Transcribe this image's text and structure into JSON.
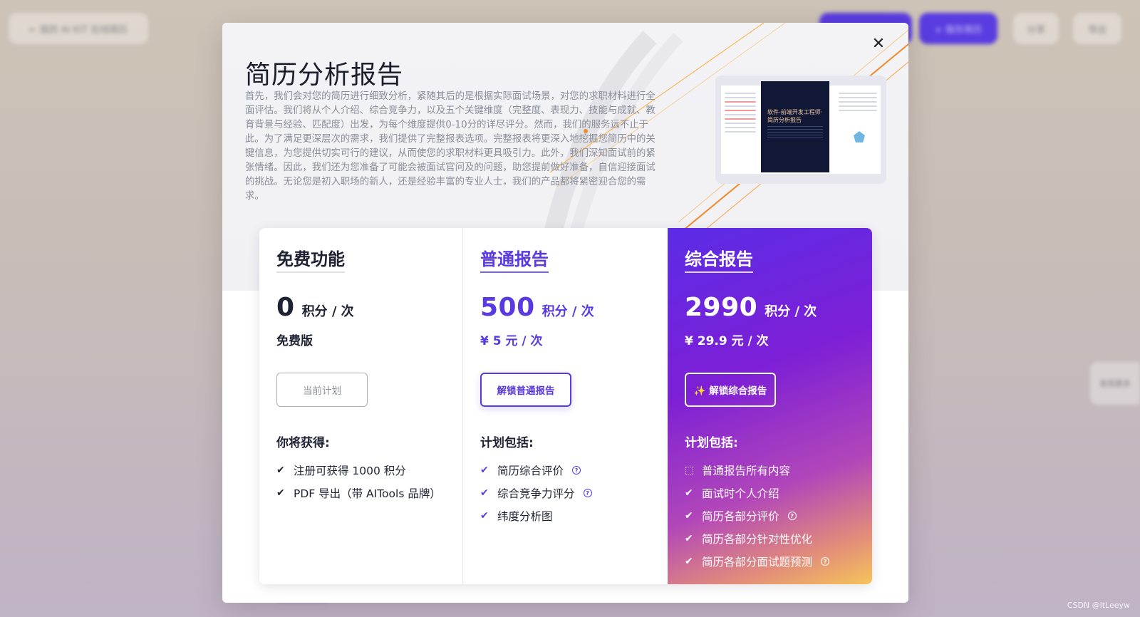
{
  "background": {
    "top_left_pill": "← 我的 AI KIT 在线简历",
    "pill_1": "",
    "pill_2": "+ 保存简历",
    "pill_3": "分享",
    "pill_4": "导出",
    "side_tab": "发现更多"
  },
  "modal": {
    "close_label": "✕",
    "title": "简历分析报告",
    "description": "首先，我们会对您的简历进行细致分析，紧随其后的是根据实际面试场景，对您的求职材料进行全面评估。我们将从个人介绍、综合竞争力，以及五个关键维度（完整度、表现力、技能与成就、教育背景与经验、匹配度）出发，为每个维度提供0-10分的详尽评分。然而，我们的服务远不止于此。为了满足更深层次的需求，我们提供了完整报表选项。完整报表将更深入地挖掘您简历中的关键信息，为您提供切实可行的建议，从而使您的求职材料更具吸引力。此外，我们深知面试前的紧张情绪。因此，我们还为您准备了可能会被面试官问及的问题，助您提前做好准备，自信迎接面试的挑战。无论您是初入职场的新人，还是经验丰富的专业人士，我们的产品都将紧密迎合您的需求。",
    "preview_cover_text": "软件-前端开发工程师·简历分析报告"
  },
  "plans": {
    "free": {
      "name": "免费功能",
      "price": "0",
      "unit": "积分 / 次",
      "sub": "免费版",
      "button": "当前计划",
      "features_title": "你将获得:",
      "features": [
        "注册可获得 1000 积分",
        "PDF 导出（带 AITools 品牌）"
      ]
    },
    "normal": {
      "name": "普通报告",
      "price": "500",
      "unit": "积分 / 次",
      "sub": "¥ 5  元 / 次",
      "button": "解锁普通报告",
      "features_title": "计划包括:",
      "features": [
        "简历综合评价",
        "综合竞争力评分",
        "纬度分析图"
      ]
    },
    "pro": {
      "name": "综合报告",
      "price": "2990",
      "unit": "积分 / 次",
      "sub": "¥ 29.9  元 / 次",
      "button": "✨ 解锁综合报告",
      "features_title": "计划包括:",
      "features": [
        "普通报告所有内容",
        "面试时个人介绍",
        "简历各部分评价",
        "简历各部分针对性优化",
        "简历各部分面试题预测"
      ]
    }
  },
  "icons": {
    "check": "check-icon",
    "help": "question-circle-icon",
    "box": "box-icon",
    "close": "close-icon",
    "sparkle": "sparkle-icon"
  },
  "colors": {
    "accent": "#5a3ae0",
    "pro_gradient_start": "#5b2ce6",
    "pro_gradient_end": "#f5c35a"
  },
  "watermark": "CSDN @ltLeeyw"
}
